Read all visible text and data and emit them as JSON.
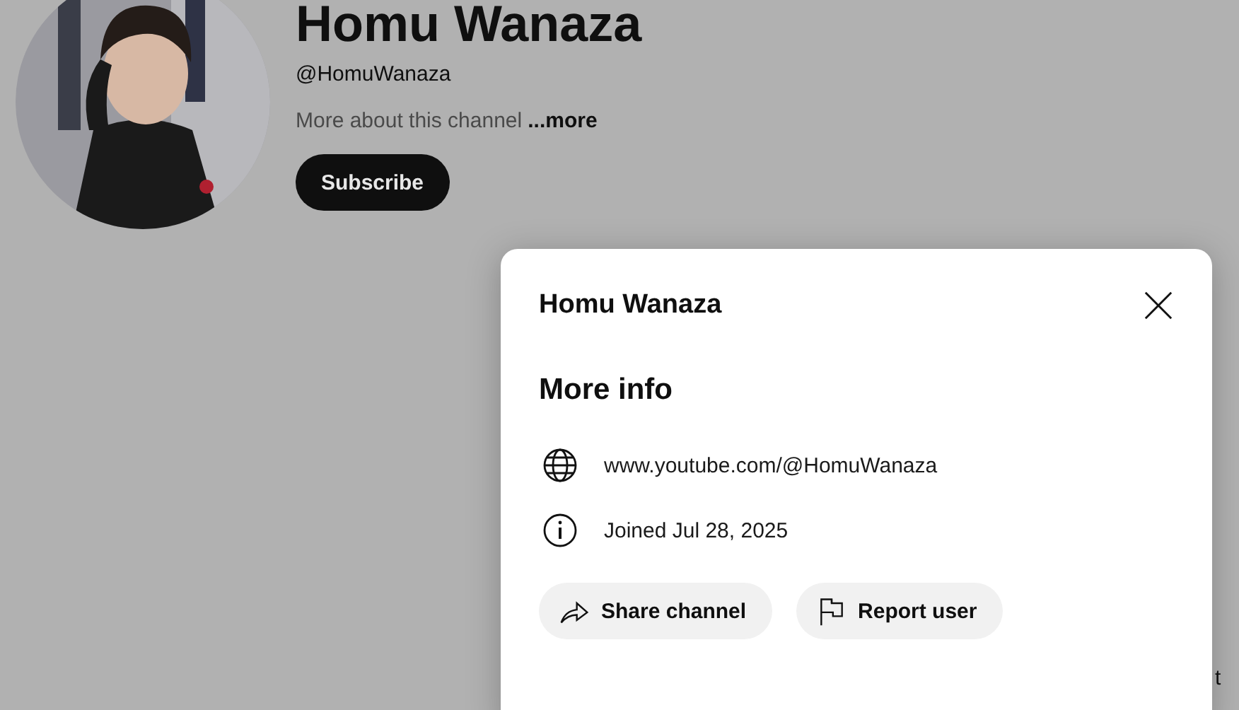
{
  "channel": {
    "name": "Homu Wanaza",
    "handle": "@HomuWanaza",
    "description": "More about this channel",
    "more_link": "...more",
    "subscribe_button": "Subscribe"
  },
  "background_fragment": "t",
  "dialog": {
    "title": "Homu Wanaza",
    "section_title": "More info",
    "details": [
      {
        "kind": "link",
        "text": "www.youtube.com/@HomuWanaza"
      },
      {
        "kind": "joined",
        "text": "Joined Jul 28, 2025"
      }
    ],
    "buttons": [
      {
        "kind": "share",
        "label": "Share channel"
      },
      {
        "kind": "report",
        "label": "Report user"
      }
    ]
  }
}
